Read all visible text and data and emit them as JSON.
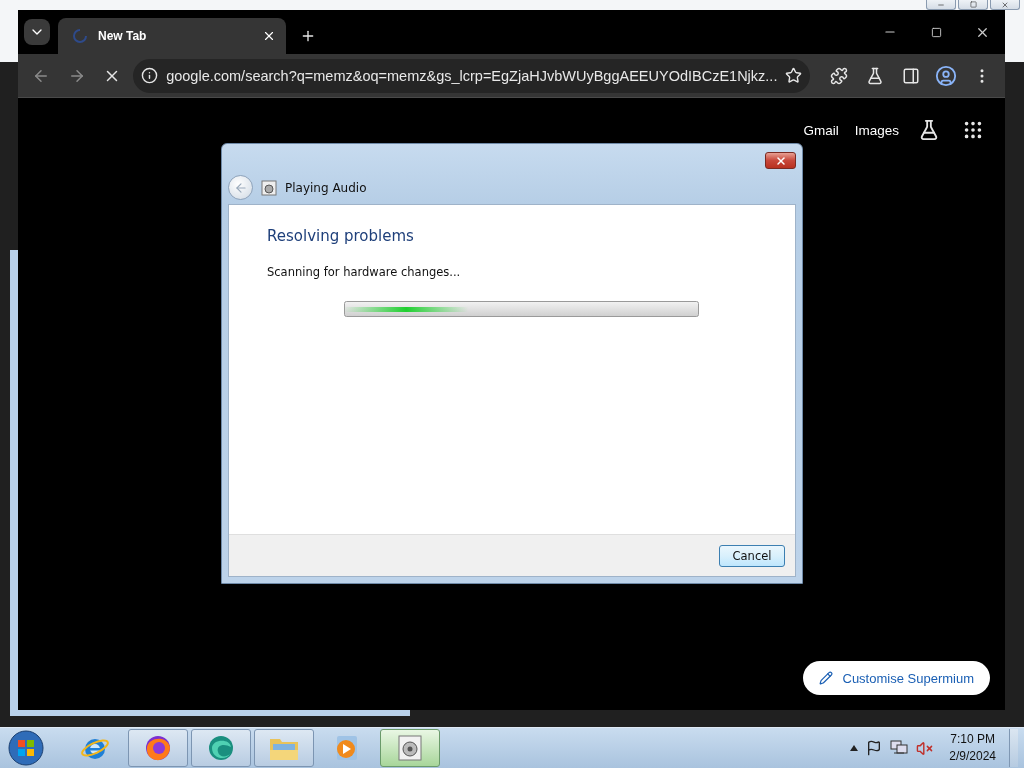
{
  "browser": {
    "tabs": [
      {
        "title": "New Tab",
        "selected": true
      }
    ],
    "address": "google.com/search?q=memz&oq=memz&gs_lcrp=EgZjaHJvbWUyBggAEEUYOdIBCzE1Njkz...",
    "loading": true,
    "page": {
      "links": [
        "Gmail",
        "Images"
      ],
      "customise_button": "Customise Supermium"
    }
  },
  "dialog": {
    "title": "Playing Audio",
    "heading": "Resolving problems",
    "status": "Scanning for hardware changes...",
    "progress": {
      "level": 0.35
    },
    "cancel": "Cancel"
  },
  "taskbar": {
    "apps": [
      {
        "kind": "browser-e",
        "open": false,
        "selected": false
      },
      {
        "kind": "fox",
        "open": true,
        "selected": false
      },
      {
        "kind": "swirl",
        "open": true,
        "selected": false
      },
      {
        "kind": "folder",
        "open": true,
        "selected": false
      },
      {
        "kind": "media",
        "open": false,
        "selected": false
      },
      {
        "kind": "troubleshooter",
        "open": true,
        "selected": true
      }
    ],
    "clock": {
      "time": "7:10 PM",
      "date": "2/9/2024"
    }
  }
}
